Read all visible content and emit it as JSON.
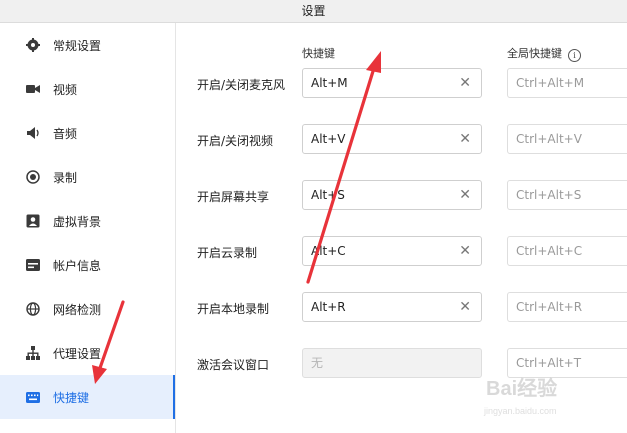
{
  "window": {
    "title": "设置"
  },
  "sidebar": {
    "items": [
      {
        "label": "常规设置",
        "icon": "gear-icon",
        "active": false
      },
      {
        "label": "视频",
        "icon": "camera-icon",
        "active": false
      },
      {
        "label": "音频",
        "icon": "speaker-icon",
        "active": false
      },
      {
        "label": "录制",
        "icon": "record-icon",
        "active": false
      },
      {
        "label": "虚拟背景",
        "icon": "portrait-icon",
        "active": false
      },
      {
        "label": "帐户信息",
        "icon": "card-icon",
        "active": false
      },
      {
        "label": "网络检测",
        "icon": "globe-icon",
        "active": false
      },
      {
        "label": "代理设置",
        "icon": "network-icon",
        "active": false
      },
      {
        "label": "快捷键",
        "icon": "keyboard-icon",
        "active": true
      }
    ]
  },
  "shortcuts": {
    "col_shortcut": "快捷键",
    "col_global": "全局快捷键",
    "info_glyph": "i",
    "clear_glyph": "✕",
    "rows": [
      {
        "label": "开启/关闭麦克风",
        "shortcut": "Alt+M",
        "global": "Ctrl+Alt+M"
      },
      {
        "label": "开启/关闭视频",
        "shortcut": "Alt+V",
        "global": "Ctrl+Alt+V"
      },
      {
        "label": "开启屏幕共享",
        "shortcut": "Alt+S",
        "global": "Ctrl+Alt+S"
      },
      {
        "label": "开启云录制",
        "shortcut": "Alt+C",
        "global": "Ctrl+Alt+C"
      },
      {
        "label": "开启本地录制",
        "shortcut": "Alt+R",
        "global": "Ctrl+Alt+R"
      },
      {
        "label": "激活会议窗口",
        "shortcut": "无",
        "global": "Ctrl+Alt+T",
        "disabled": true
      }
    ]
  },
  "watermark": {
    "brand": "Bai经验",
    "url": "jingyan.baidu.com"
  },
  "colors": {
    "accent": "#1f6fe5",
    "arrow": "#e8333a",
    "active_bg": "#e6effd"
  }
}
